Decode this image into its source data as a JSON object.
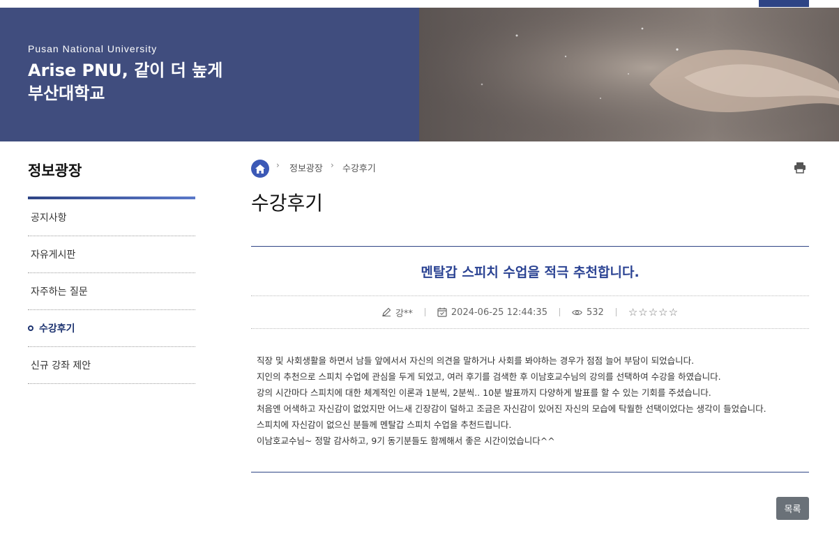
{
  "hero": {
    "subtitle": "Pusan National University",
    "title_line1": "Arise PNU, 같이 더 높게",
    "title_line2": "부산대학교"
  },
  "sidebar": {
    "title": "정보광장",
    "items": [
      {
        "label": "공지사항"
      },
      {
        "label": "자유게시판"
      },
      {
        "label": "자주하는 질문"
      },
      {
        "label": "수강후기"
      },
      {
        "label": "신규 강좌 제안"
      }
    ],
    "active_index": 3
  },
  "breadcrumb": {
    "items": [
      "정보광장",
      "수강후기"
    ],
    "icons": {
      "home": "home-icon",
      "separator": "chevron-right-icon",
      "print": "print-icon"
    }
  },
  "page_title": "수강후기",
  "post": {
    "title": "멘탈갑 스피치 수업을 적극 추천합니다.",
    "author": "강**",
    "date": "2024-06-25 12:44:35",
    "views": "532",
    "stars": "☆☆☆☆☆",
    "rating": 0,
    "body": [
      "직장 및 사회생활을 하면서 남들 앞에서서 자신의 의견을 말하거나 사회를 봐야하는 경우가 점점 늘어 부담이 되었습니다.",
      "지인의 추천으로 스피치 수업에 관심을 두게 되었고, 여러 후기를 검색한 후 이남호교수님의 강의를 선택하여 수강을 하였습니다.",
      "강의 시간마다 스피치에 대한 체계적인 이론과 1분씩, 2분씩.. 10분 발표까지 다양하게 발표를 할 수 있는 기회를 주셨습니다.",
      "처음엔 어색하고 자신감이 없었지만 어느새 긴장감이 덜하고 조금은 자신감이 있어진 자신의 모습에 탁월한 선택이었다는 생각이 들었습니다.",
      "스피치에 자신감이 없으신 분들께 멘탈갑 스피치 수업을 추천드립니다.",
      "이남호교수님~ 정말 감사하고, 9기 동기분들도 함께해서 좋은 시간이었습니다^^"
    ]
  },
  "buttons": {
    "list": "목록"
  },
  "colors": {
    "primary": "#2e4485",
    "accent": "#3c59b6",
    "hero_left": "#404d7e",
    "button": "#6a7178"
  }
}
